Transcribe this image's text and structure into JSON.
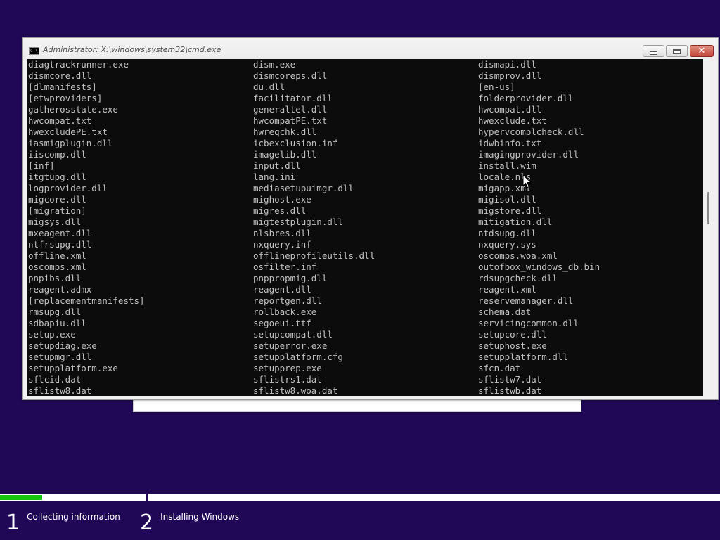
{
  "window": {
    "title": "Administrator: X:\\windows\\system32\\cmd.exe",
    "icon_text": "C:\\"
  },
  "console": {
    "rows": [
      [
        "diagtrackrunner.exe",
        "dism.exe",
        "dismapi.dll"
      ],
      [
        "dismcore.dll",
        "dismcoreps.dll",
        "dismprov.dll"
      ],
      [
        "[dlmanifests]",
        "du.dll",
        "[en-us]"
      ],
      [
        "[etwproviders]",
        "facilitator.dll",
        "folderprovider.dll"
      ],
      [
        "gatherosstate.exe",
        "generaltel.dll",
        "hwcompat.dll"
      ],
      [
        "hwcompat.txt",
        "hwcompatPE.txt",
        "hwexclude.txt"
      ],
      [
        "hwexcludePE.txt",
        "hwreqchk.dll",
        "hypervcomplcheck.dll"
      ],
      [
        "iasmigplugin.dll",
        "icbexclusion.inf",
        "idwbinfo.txt"
      ],
      [
        "iiscomp.dll",
        "imagelib.dll",
        "imagingprovider.dll"
      ],
      [
        "[inf]",
        "input.dll",
        "install.wim"
      ],
      [
        "itgtupg.dll",
        "lang.ini",
        "locale.nls"
      ],
      [
        "logprovider.dll",
        "mediasetupuimgr.dll",
        "migapp.xml"
      ],
      [
        "migcore.dll",
        "mighost.exe",
        "migisol.dll"
      ],
      [
        "[migration]",
        "migres.dll",
        "migstore.dll"
      ],
      [
        "migsys.dll",
        "migtestplugin.dll",
        "mitigation.dll"
      ],
      [
        "mxeagent.dll",
        "nlsbres.dll",
        "ntdsupg.dll"
      ],
      [
        "ntfrsupg.dll",
        "nxquery.inf",
        "nxquery.sys"
      ],
      [
        "offline.xml",
        "offlineprofileutils.dll",
        "oscomps.woa.xml"
      ],
      [
        "oscomps.xml",
        "osfilter.inf",
        "outofbox_windows_db.bin"
      ],
      [
        "pnpibs.dll",
        "pnppropmig.dll",
        "rdsupgcheck.dll"
      ],
      [
        "reagent.admx",
        "reagent.dll",
        "reagent.xml"
      ],
      [
        "[replacementmanifests]",
        "reportgen.dll",
        "reservemanager.dll"
      ],
      [
        "rmsupg.dll",
        "rollback.exe",
        "schema.dat"
      ],
      [
        "sdbapiu.dll",
        "segoeui.ttf",
        "servicingcommon.dll"
      ],
      [
        "setup.exe",
        "setupcompat.dll",
        "setupcore.dll"
      ],
      [
        "setupdiag.exe",
        "setuperror.exe",
        "setuphost.exe"
      ],
      [
        "setupmgr.dll",
        "setupplatform.cfg",
        "setupplatform.dll"
      ],
      [
        "setupplatform.exe",
        "setupprep.exe",
        "sfcn.dat"
      ],
      [
        "sflcid.dat",
        "sflistrs1.dat",
        "sflistw7.dat"
      ],
      [
        "sflistw8.dat",
        "sflistw8.woa.dat",
        "sflistwb.dat"
      ]
    ]
  },
  "progress": {
    "step1_fraction": 0.29
  },
  "steps": [
    {
      "number": "1",
      "label": "Collecting information"
    },
    {
      "number": "2",
      "label": "Installing Windows"
    }
  ],
  "colors": {
    "background": "#200857",
    "progress_fill": "#16c60c",
    "console_text": "#c0c0c0"
  }
}
